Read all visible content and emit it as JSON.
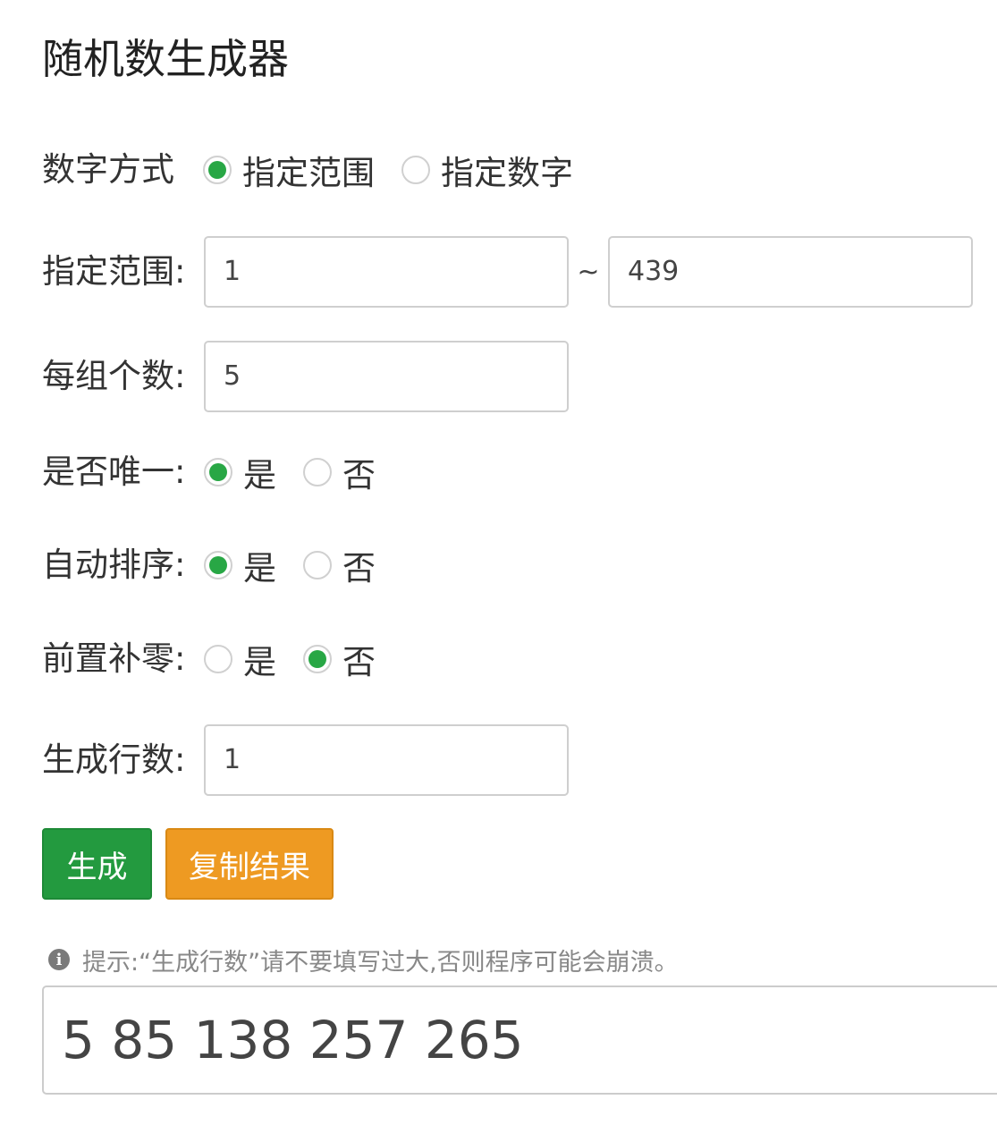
{
  "title": "随机数生成器",
  "mode": {
    "label": "数字方式",
    "options": [
      {
        "label": "指定范围",
        "checked": true
      },
      {
        "label": "指定数字",
        "checked": false
      }
    ]
  },
  "range": {
    "label": "指定范围:",
    "min": "1",
    "separator": "~",
    "max": "439"
  },
  "per_group": {
    "label": "每组个数:",
    "value": "5"
  },
  "unique": {
    "label": "是否唯一:",
    "options": [
      {
        "label": "是",
        "checked": true
      },
      {
        "label": "否",
        "checked": false
      }
    ]
  },
  "auto_sort": {
    "label": "自动排序:",
    "options": [
      {
        "label": "是",
        "checked": true
      },
      {
        "label": "否",
        "checked": false
      }
    ]
  },
  "zero_pad": {
    "label": "前置补零:",
    "options": [
      {
        "label": "是",
        "checked": false
      },
      {
        "label": "否",
        "checked": true
      }
    ]
  },
  "rows": {
    "label": "生成行数:",
    "value": "1"
  },
  "buttons": {
    "generate": "生成",
    "copy": "复制结果"
  },
  "hint": {
    "icon": "info-icon",
    "text": "提示:“生成行数”请不要填写过大,否则程序可能会崩溃。"
  },
  "result": "5 85 138 257 265",
  "colors": {
    "radio_checked": "#28a745",
    "generate_button": "#239a3f",
    "copy_button": "#ee9a22"
  }
}
